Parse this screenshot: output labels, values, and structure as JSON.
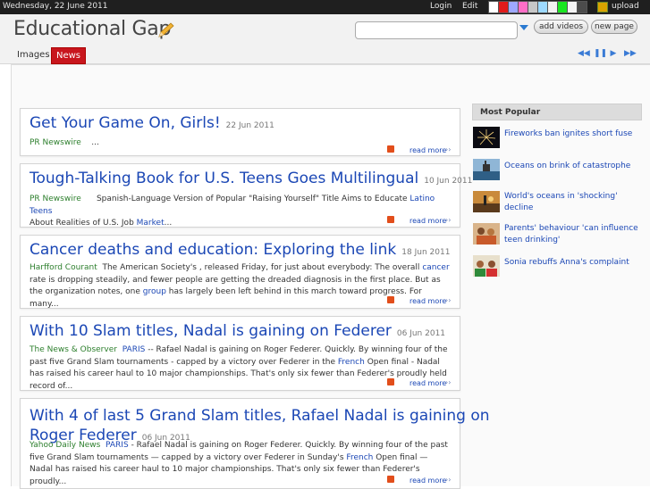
{
  "topbar": {
    "date": "Wednesday, 22 June 2011",
    "login": "Login",
    "edit": "Edit",
    "upload": "upload",
    "swatch_colors": [
      "#ffffff",
      "#e01b1b",
      "#9ea8ff",
      "#ff6ec7",
      "#c7c7c7",
      "#9dd9ff",
      "#f1f1f1",
      "#19e620",
      "#f4f4f4",
      "#4c4c4c"
    ]
  },
  "header": {
    "site_title": "Educational Gap",
    "search_placeholder": "",
    "add_videos": "add videos",
    "new_page": "new page"
  },
  "nav": {
    "images": "Images",
    "news": "News",
    "controls": [
      "previous-icon",
      "pause-icon",
      "play-icon",
      "next-icon"
    ]
  },
  "articles": [
    {
      "title": "Get Your Game On, Girls!",
      "date": "22 Jun 2011",
      "source": "PR Newswire",
      "text_a": "...",
      "keyword": "",
      "text_b": "",
      "read_more": "read more"
    },
    {
      "title": "Tough-Talking Book for U.S. Teens Goes Multilingual",
      "date": "10 Jun 2011",
      "source": "PR Newswire",
      "text_a": "Spanish-Language Version of Popular \"Raising Yourself\" Title Aims to Educate",
      "keyword": "Latino Teens",
      "text_b": "About Realities of U.S. Job",
      "keyword2": "Market",
      "tail": "...",
      "read_more": "read more"
    },
    {
      "title": "Cancer deaths and education: Exploring the link",
      "date": "18 Jun 2011",
      "source": "Harfford Courant",
      "text_a": "The American Society's , released Friday, for just about everybody: The overall",
      "keyword": "cancer",
      "text_b": "rate is dropping steadily, and fewer people are getting the dreaded diagnosis in the first place. But as the organization notes, one",
      "keyword2": "group",
      "tail": "has largely been left behind in this march toward progress. For many...",
      "read_more": "read more"
    },
    {
      "title": "With 10 Slam titles, Nadal is gaining on Federer",
      "date": "06 Jun 2011",
      "source": "The News & Observer",
      "keyword": "PARIS",
      "text_a": "-- Rafael Nadal is gaining on Roger Federer. Quickly. By winning four of the past five Grand Slam tournaments - capped by a victory over Federer in the",
      "keyword2": "French",
      "tail": "Open final - Nadal has raised his career haul to 10 major championships. That's only six fewer than Federer's proudly held record of...",
      "read_more": "read more"
    },
    {
      "title": "With 4 of last 5 Grand Slam titles, Rafael Nadal is gaining on Roger Federer",
      "title_line1": "With 4 of last 5 Grand Slam titles, Rafael Nadal is gaining on",
      "title_line2": "Roger Federer",
      "date": "06 Jun 2011",
      "source": "Yahoo Daily News",
      "keyword": "PARIS",
      "text_a": "- Rafael Nadal is gaining on Roger Federer. Quickly. By winning four of the past five Grand Slam tournaments — capped by a victory over Federer in Sunday's",
      "keyword2": "French",
      "tail": "Open final — Nadal has raised his career haul to 10 major championships. That's only six fewer than Federer's proudly...",
      "read_more": "read more"
    }
  ],
  "sidebar": {
    "heading": "Most Popular",
    "items": [
      {
        "text": "Fireworks ban ignites short fuse",
        "thumb": "fireworks-thumbnail"
      },
      {
        "text": "Oceans on brink of catastrophe",
        "thumb": "ocean-rig-thumbnail"
      },
      {
        "text": "World's oceans in 'shocking' decline",
        "thumb": "sunset-ocean-thumbnail"
      },
      {
        "text": "Parents' behaviour 'can influence teen drinking'",
        "thumb": "family-thumbnail"
      },
      {
        "text": "Sonia rebuffs Anna's complaint",
        "thumb": "crowd-thumbnail"
      }
    ]
  }
}
